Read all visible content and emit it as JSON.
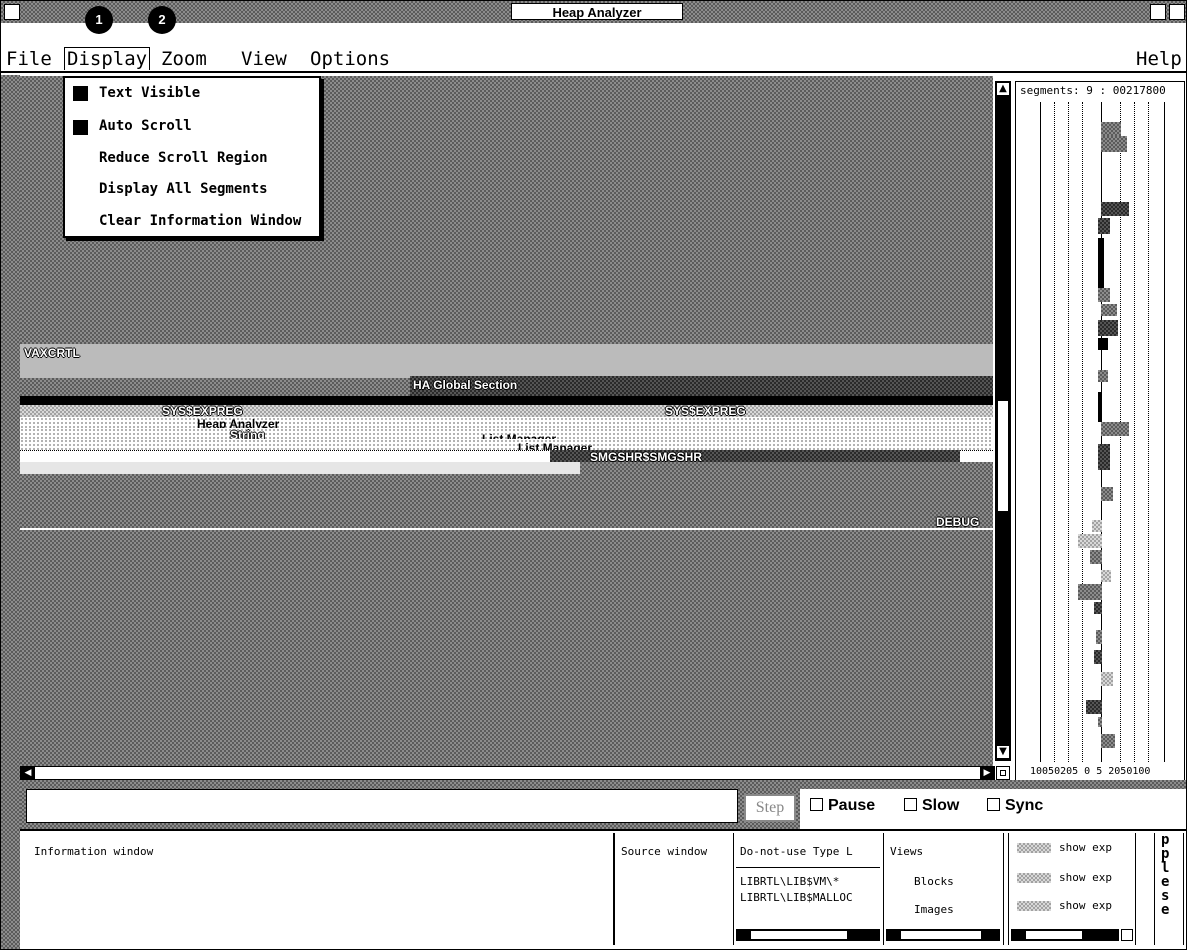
{
  "window": {
    "title": "Heap Analyzer"
  },
  "callouts": [
    "1",
    "2"
  ],
  "menubar": {
    "items": [
      "File",
      "Display",
      "Zoom",
      "View",
      "Options"
    ],
    "help": "Help"
  },
  "display_menu": {
    "items": [
      {
        "label": "Text Visible",
        "checked": true
      },
      {
        "label": "Auto Scroll",
        "checked": true
      },
      {
        "label": "Reduce Scroll Region",
        "checked": false
      },
      {
        "label": "Display All Segments",
        "checked": false
      },
      {
        "label": "Clear Information Window",
        "checked": false
      }
    ]
  },
  "canvas": {
    "labels": {
      "vaxcrtl": "VAXCRTL",
      "ha_global": "HA Global Section",
      "sys_exprec1": "SYS$EXPREG",
      "sys_exprec2": "SYS$EXPREG",
      "heap_analyzer": "Heap Analyzer",
      "string": "String",
      "list_manager1": "List Manager",
      "list_manager2": "List Manager",
      "smgshr": "SMGSHR$SMGSHR",
      "debug": "DEBUG"
    }
  },
  "segments_panel": {
    "header": "segments: 9 : 00217800",
    "footer": "10050205 0 5 2050100"
  },
  "controls": {
    "step": "Step",
    "pause": "Pause",
    "slow": "Slow",
    "sync": "Sync"
  },
  "bottom": {
    "information": "Information window",
    "source": "Source window",
    "do_not_use": {
      "header": "Do-not-use Type L",
      "entries": [
        "LIBRTL\\LIB$VM\\*",
        "LIBRTL\\LIB$MALLOC"
      ]
    },
    "views": {
      "header": "Views",
      "items": [
        "Blocks",
        "Images"
      ]
    },
    "show_exp": [
      "show  exp",
      "show  exp",
      "show  exp"
    ],
    "side_letters": [
      "p",
      "p",
      "l",
      "e",
      "s",
      "e"
    ]
  }
}
